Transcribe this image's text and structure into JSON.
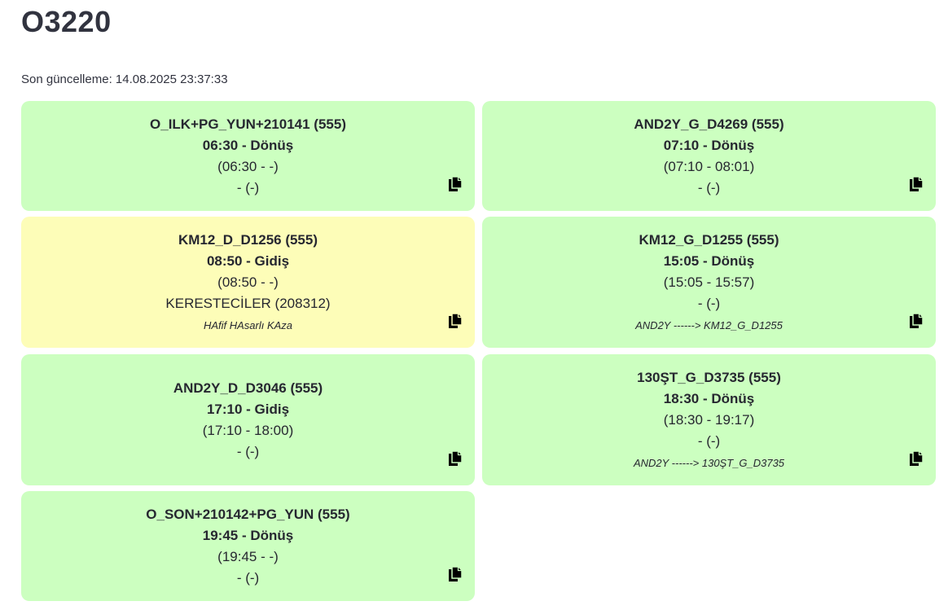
{
  "page": {
    "title": "O3220",
    "last_update": "Son güncelleme: 14.08.2025 23:37:33"
  },
  "colors": {
    "card_green": "#ccffc0",
    "card_yellow": "#fdfdb8"
  },
  "cards": [
    {
      "name": "O_ILK+PG_YUN+210141 (555)",
      "time": "06:30 - Dönüş",
      "window": "(06:30 - -)",
      "place": "- (-)",
      "note": "",
      "status": "green",
      "icon": "copy-icon"
    },
    {
      "name": "AND2Y_G_D4269 (555)",
      "time": "07:10 - Dönüş",
      "window": "(07:10 - 08:01)",
      "place": "- (-)",
      "note": "",
      "status": "green",
      "icon": "copy-icon"
    },
    {
      "name": "KM12_D_D1256 (555)",
      "time": "08:50 - Gidiş",
      "window": "(08:50 - -)",
      "place": "KERESTECİLER (208312)",
      "note": "HAfif HAsarlı KAza",
      "status": "yellow",
      "icon": "copy-icon"
    },
    {
      "name": "KM12_G_D1255 (555)",
      "time": "15:05 - Dönüş",
      "window": "(15:05 - 15:57)",
      "place": "- (-)",
      "note": "AND2Y ------> KM12_G_D1255",
      "status": "green",
      "icon": "copy-icon"
    },
    {
      "name": "AND2Y_D_D3046 (555)",
      "time": "17:10 - Gidiş",
      "window": "(17:10 - 18:00)",
      "place": "- (-)",
      "note": "",
      "status": "green",
      "icon": "copy-icon"
    },
    {
      "name": "130ŞT_G_D3735 (555)",
      "time": "18:30 - Dönüş",
      "window": "(18:30 - 19:17)",
      "place": "- (-)",
      "note": "AND2Y ------> 130ŞT_G_D3735",
      "status": "green",
      "icon": "copy-icon"
    },
    {
      "name": "O_SON+210142+PG_YUN (555)",
      "time": "19:45 - Dönüş",
      "window": "(19:45 - -)",
      "place": "- (-)",
      "note": "",
      "status": "green",
      "icon": "copy-icon"
    }
  ]
}
